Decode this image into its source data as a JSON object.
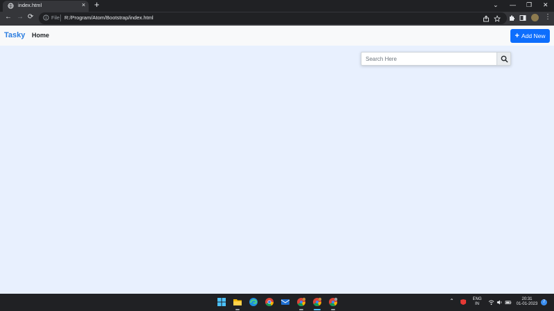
{
  "browser": {
    "tab_title": "index.html",
    "tab_close": "×",
    "new_tab": "+",
    "window_controls": {
      "chevron": "⌄",
      "minimize": "—",
      "restore": "❐",
      "close": "✕"
    },
    "nav": {
      "back": "←",
      "forward": "→",
      "reload": "⟳"
    },
    "file_label": "File",
    "url": "R:/Program/Atom/Bootstrap/index.html",
    "menu": "⋮"
  },
  "navbar": {
    "brand": "Tasky",
    "home": "Home",
    "add_button_icon": "+",
    "add_button_label": "Add New"
  },
  "search": {
    "placeholder": "Search Here",
    "value": ""
  },
  "taskbar": {
    "tray_lang": "ENG",
    "tray_region": "IN",
    "time": "20:31",
    "date": "01-01-2023",
    "up_arrow": "⌃",
    "notification_count": "7"
  },
  "colors": {
    "accent": "#0d6efd",
    "brand": "#2b7de0",
    "page_bg": "#e8f0fe"
  }
}
